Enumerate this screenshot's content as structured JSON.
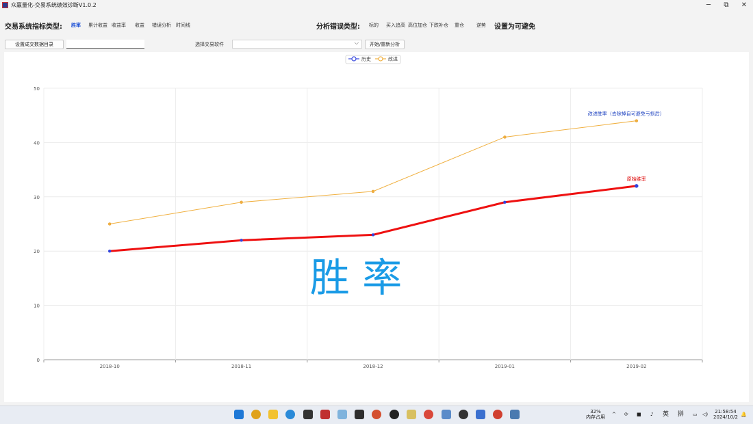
{
  "window": {
    "title": "众赢量化-交易系统绩效诊断V1.0.2",
    "minimize": "─",
    "maximize": "⧉",
    "close": "✕"
  },
  "toolbar": {
    "metric_label": "交易系统指标类型:",
    "metric_tabs": [
      "胜率",
      "累计收益",
      "收益率",
      "收益",
      "错误分析",
      "时间线"
    ],
    "error_label": "分析错误类型:",
    "error_items": [
      "标的",
      "买入追高",
      "高位加仓",
      "下跌补仓",
      "重仓",
      "逆势"
    ],
    "avoid_label": "设置为可避免",
    "set_dir_button": "设置成交数据目录",
    "dir_value": "",
    "software_label": "选择交易软件",
    "software_value": "",
    "start_button": "开始/重新分析"
  },
  "chart_data": {
    "type": "line",
    "categories": [
      "2018-10",
      "2018-11",
      "2018-12",
      "2019-01",
      "2019-02"
    ],
    "series": [
      {
        "name": "历史",
        "values": [
          20,
          22,
          23,
          29,
          32
        ],
        "color": "#ee1111",
        "marker": "#3344dd",
        "end_label": "原始胜率",
        "end_label_color": "#dd0000"
      },
      {
        "name": "改进",
        "values": [
          25,
          29,
          31,
          41,
          44
        ],
        "color": "#f0b040",
        "marker": "#f0b040",
        "end_label": "改进胜率（去除掉自可避免亏损后）",
        "end_label_color": "#1a3fbf"
      }
    ],
    "ylim": [
      0,
      50
    ],
    "yticks": [
      0,
      10,
      20,
      30,
      40,
      50
    ],
    "grid": true,
    "legend": "top-center",
    "watermark": "胜 率",
    "watermark_color": "#1a9be6"
  },
  "taskbar": {
    "mem_percent": "32%",
    "mem_label": "内存占用",
    "ime_1": "英",
    "ime_2": "拼",
    "time": "21:58:54",
    "date": "2024/10/2"
  }
}
